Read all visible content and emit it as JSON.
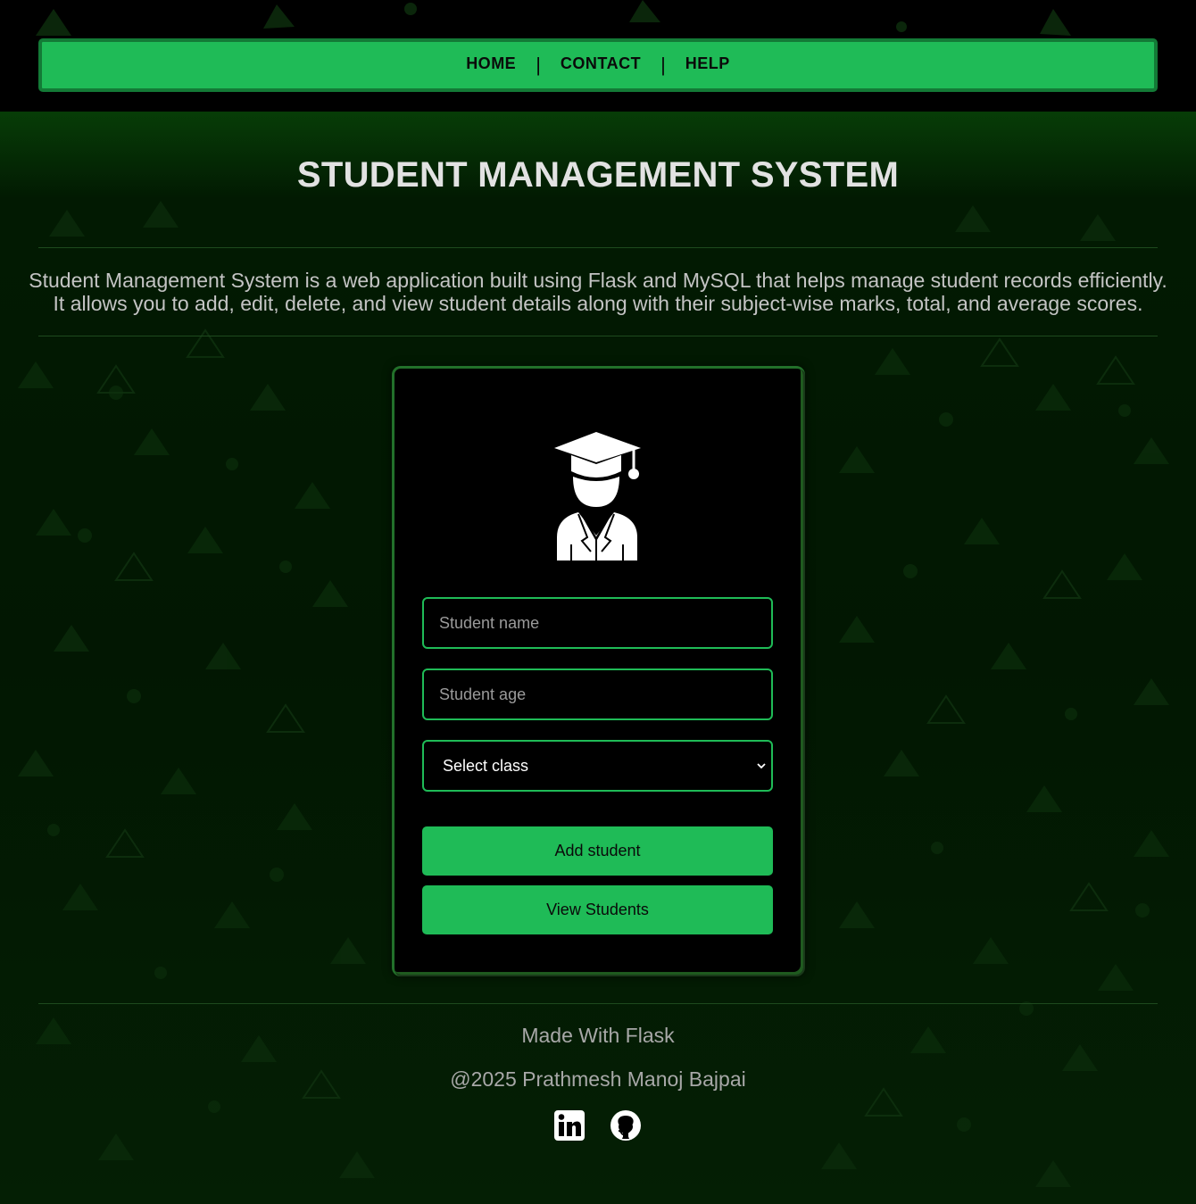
{
  "nav": {
    "items": [
      {
        "label": "HOME"
      },
      {
        "label": "CONTACT"
      },
      {
        "label": "HELP"
      }
    ],
    "separator": "|"
  },
  "header": {
    "title": "STUDENT MANAGEMENT SYSTEM"
  },
  "description": {
    "line1": "Student Management System is a web application built using Flask and MySQL that helps manage student records efficiently.",
    "line2": "It allows you to add, edit, delete, and view student details along with their subject-wise marks, total, and average scores."
  },
  "form": {
    "icon": "student-graduate-icon",
    "name_placeholder": "Student name",
    "age_placeholder": "Student age",
    "class_select": {
      "selected": "Select class"
    },
    "add_button": "Add student",
    "view_button": "View Students"
  },
  "footer": {
    "made_with": "Made With Flask",
    "copyright": "@2025 Prathmesh Manoj Bajpai",
    "social": [
      {
        "icon": "linkedin-icon"
      },
      {
        "icon": "github-icon"
      }
    ]
  },
  "colors": {
    "accent": "#1fbb57",
    "background": "#021702",
    "card": "#000000",
    "text": "#e2e2e2"
  }
}
